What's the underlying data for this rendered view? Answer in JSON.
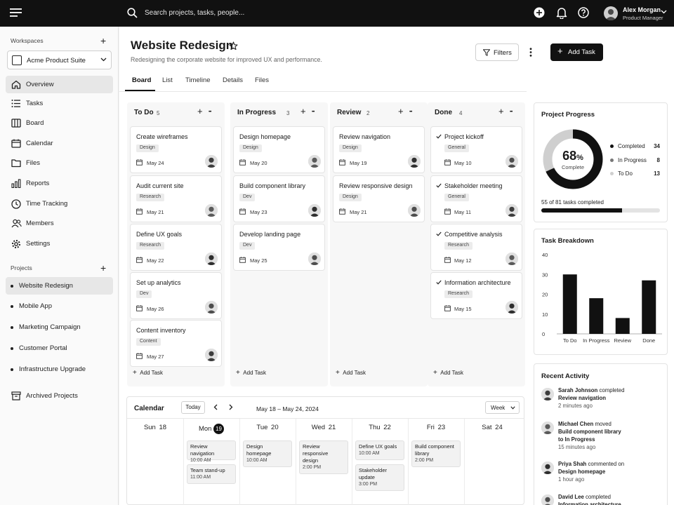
{
  "topbar": {
    "search_placeholder": "Search projects, tasks, people...",
    "user_name": "Alex Morgan",
    "user_role": "Product Manager"
  },
  "sidebar": {
    "workspaces_label": "Workspaces",
    "workspace_name": "Acme Product Suite",
    "nav": [
      {
        "label": "Overview",
        "icon": "home-icon"
      },
      {
        "label": "Tasks",
        "icon": "list-icon"
      },
      {
        "label": "Board",
        "icon": "board-icon"
      },
      {
        "label": "Calendar",
        "icon": "calendar-icon"
      },
      {
        "label": "Files",
        "icon": "folder-icon"
      },
      {
        "label": "Reports",
        "icon": "bar-chart-icon"
      },
      {
        "label": "Time Tracking",
        "icon": "clock-icon"
      },
      {
        "label": "Members",
        "icon": "users-icon"
      },
      {
        "label": "Settings",
        "icon": "gear-icon"
      }
    ],
    "projects_label": "Projects",
    "projects": [
      "Website Redesign",
      "Mobile App",
      "Marketing Campaign",
      "Customer Portal",
      "Infrastructure Upgrade"
    ],
    "archived_label": "Archived Projects"
  },
  "header": {
    "title": "Website Redesign",
    "subtitle": "Redesigning the corporate website for improved UX and performance.",
    "filters_label": "Filters",
    "add_task_label": "Add Task"
  },
  "tabs": [
    "Board",
    "List",
    "Timeline",
    "Details",
    "Files"
  ],
  "board": {
    "add_task_label": "Add Task",
    "columns": [
      {
        "name": "To Do",
        "count": "5",
        "cards": [
          {
            "title": "Create wireframes",
            "tag": "Design",
            "date": "May 24"
          },
          {
            "title": "Audit current site",
            "tag": "Research",
            "date": "May 21"
          },
          {
            "title": "Define UX goals",
            "tag": "Research",
            "date": "May 22"
          },
          {
            "title": "Set up analytics",
            "tag": "Dev",
            "date": "May 26"
          },
          {
            "title": "Content inventory",
            "tag": "Content",
            "date": "May 27"
          }
        ]
      },
      {
        "name": "In Progress",
        "count": "3",
        "cards": [
          {
            "title": "Design homepage",
            "tag": "Design",
            "date": "May 20"
          },
          {
            "title": "Build component library",
            "tag": "Dev",
            "date": "May 23"
          },
          {
            "title": "Develop landing page",
            "tag": "Dev",
            "date": "May 25"
          }
        ]
      },
      {
        "name": "Review",
        "count": "2",
        "cards": [
          {
            "title": "Review navigation",
            "tag": "Design",
            "date": "May 19"
          },
          {
            "title": "Review responsive design",
            "tag": "Design",
            "date": "May 21"
          }
        ]
      },
      {
        "name": "Done",
        "count": "4",
        "cards": [
          {
            "title": "Project kickoff",
            "tag": "General",
            "date": "May 10"
          },
          {
            "title": "Stakeholder meeting",
            "tag": "General",
            "date": "May 11"
          },
          {
            "title": "Competitive analysis",
            "tag": "Research",
            "date": "May 12"
          },
          {
            "title": "Information architecture",
            "tag": "Research",
            "date": "May 15"
          }
        ]
      }
    ]
  },
  "calendar": {
    "title": "Calendar",
    "today_label": "Today",
    "range": "May 18 – May 24, 2024",
    "view": "Week",
    "days": [
      {
        "name": "Sun",
        "num": "18"
      },
      {
        "name": "Mon",
        "num": "19"
      },
      {
        "name": "Tue",
        "num": "20"
      },
      {
        "name": "Wed",
        "num": "21"
      },
      {
        "name": "Thu",
        "num": "22"
      },
      {
        "name": "Fri",
        "num": "23"
      },
      {
        "name": "Sat",
        "num": "24"
      }
    ],
    "events": [
      {
        "name": "Review navigation",
        "time": "10:00 AM"
      },
      {
        "name": "Team stand-up",
        "time": "11:00 AM"
      },
      {
        "name": "Design homepage",
        "time": "10:00 AM"
      },
      {
        "name": "Review responsive design",
        "time": "2:00 PM"
      },
      {
        "name": "Define UX goals",
        "time": "10:00 AM"
      },
      {
        "name": "Stakeholder update",
        "time": "3:00 PM"
      },
      {
        "name": "Build component library",
        "time": "2:00 PM"
      }
    ]
  },
  "progress": {
    "title": "Project Progress",
    "percent": "68",
    "percent_sign": "%",
    "complete_label": "Complete",
    "completed_fraction": 0.68,
    "legend": [
      {
        "label": "Completed",
        "value": "34",
        "color": "#111111"
      },
      {
        "label": "In Progress",
        "value": "8",
        "color": "#777777"
      },
      {
        "label": "To Do",
        "value": "13",
        "color": "#cfcfcf"
      }
    ],
    "tasks_text": "55 of 81 tasks completed",
    "tasks_fraction": 0.68
  },
  "chart_data": {
    "type": "bar",
    "title": "Task Breakdown",
    "categories": [
      "To Do",
      "In Progress",
      "Review",
      "Done"
    ],
    "values": [
      30,
      18,
      8,
      27
    ],
    "yticks": [
      "0",
      "10",
      "20",
      "30",
      "40"
    ],
    "ylim": [
      0,
      40
    ],
    "grid": false
  },
  "activity": {
    "title": "Recent Activity",
    "items": [
      {
        "user": "Sarah Johnson",
        "verb": "completed",
        "object": "Review navigation",
        "extra": "",
        "ago": "2 minutes ago"
      },
      {
        "user": "Michael Chen",
        "verb": "moved",
        "object": "Build component library",
        "extra": "to In Progress",
        "ago": "15 minutes ago"
      },
      {
        "user": "Priya Shah",
        "verb": "commented on",
        "object": "Design homepage",
        "extra": "",
        "ago": "1 hour ago"
      },
      {
        "user": "David Lee",
        "verb": "completed",
        "object": "Information architecture",
        "extra": "",
        "ago": ""
      }
    ]
  }
}
